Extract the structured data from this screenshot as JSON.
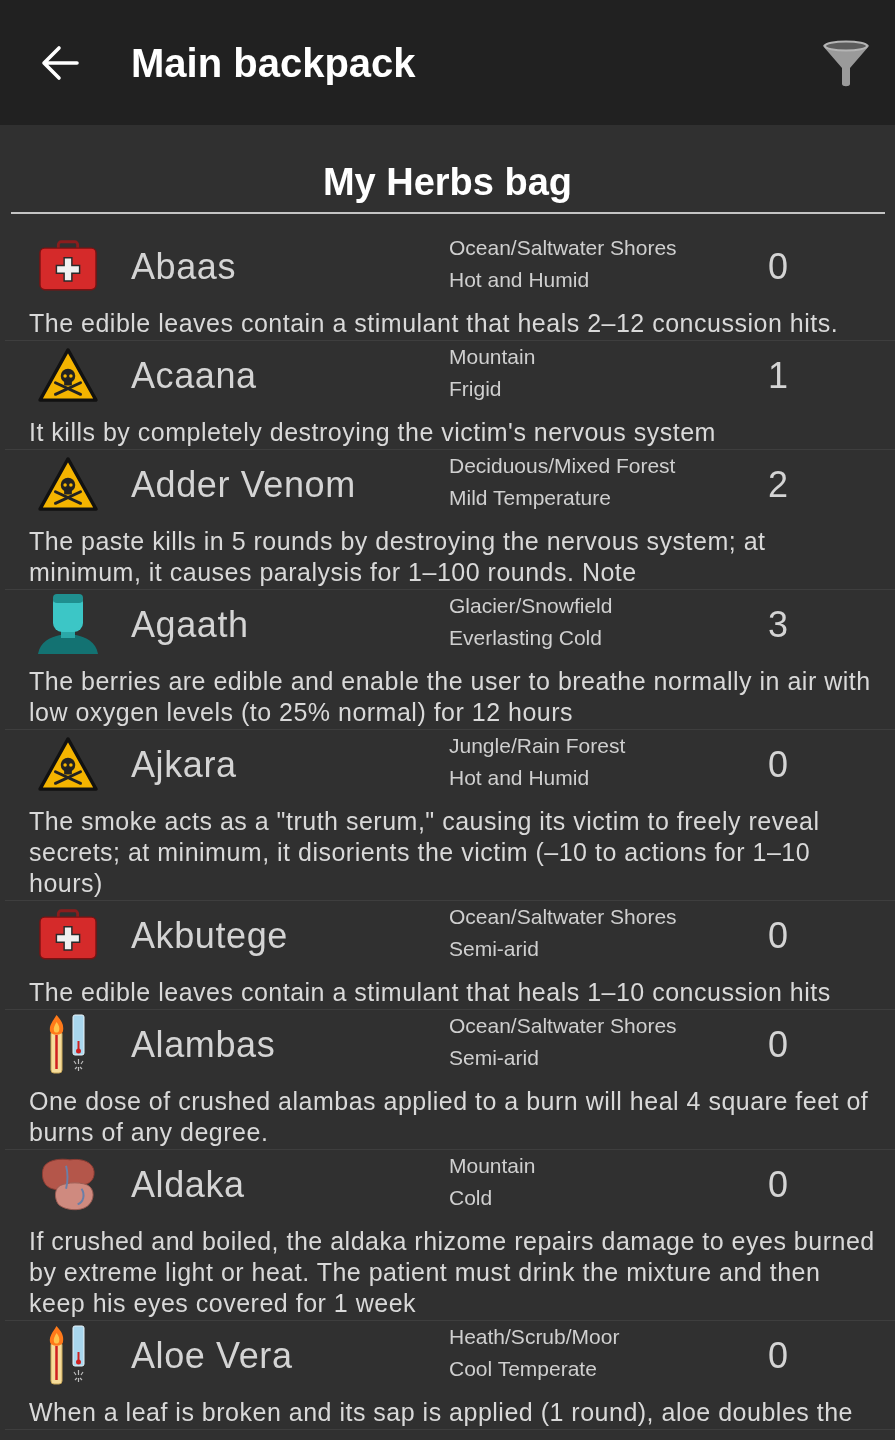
{
  "app_bar": {
    "title": "Main backpack"
  },
  "bag": {
    "title": "My Herbs bag"
  },
  "herbs": [
    {
      "kind": "medkit",
      "name": "Abaas",
      "terrain": "Ocean/Saltwater Shores",
      "climate": "Hot and Humid",
      "count": "0",
      "description": "The edible leaves contain a stimulant that heals 2–12 concussion hits."
    },
    {
      "kind": "hazard",
      "name": "Acaana",
      "terrain": "Mountain",
      "climate": "Frigid",
      "count": "1",
      "description": "It kills by completely destroying the victim's nervous system"
    },
    {
      "kind": "hazard",
      "name": "Adder Venom",
      "terrain": "Deciduous/Mixed Forest",
      "climate": "Mild Temperature",
      "count": "2",
      "description": "The paste kills in 5 rounds by destroying the nervous system; at minimum, it causes paralysis for 1–100 rounds. Note"
    },
    {
      "kind": "bust",
      "name": "Agaath",
      "terrain": "Glacier/Snowfield",
      "climate": "Everlasting Cold",
      "count": "3",
      "description": "The berries are edible and enable the user to breathe normally in air with low oxygen levels (to 25% normal) for 12 hours"
    },
    {
      "kind": "hazard",
      "name": "Ajkara",
      "terrain": "Jungle/Rain Forest",
      "climate": "Hot and Humid",
      "count": "0",
      "description": "The smoke acts as a \"truth serum,\" causing its victim to freely reveal secrets; at minimum, it disorients the victim (–10 to actions for 1–10 hours)"
    },
    {
      "kind": "medkit",
      "name": "Akbutege",
      "terrain": "Ocean/Saltwater Shores",
      "climate": "Semi-arid",
      "count": "0",
      "description": "The edible leaves contain a stimulant that heals 1–10 concussion hits"
    },
    {
      "kind": "thermometers",
      "name": "Alambas",
      "terrain": "Ocean/Saltwater Shores",
      "climate": "Semi-arid",
      "count": "0",
      "description": "One dose of crushed alambas applied to a burn will heal 4 square feet of burns of any degree."
    },
    {
      "kind": "organ",
      "name": "Aldaka",
      "terrain": "Mountain",
      "climate": "Cold",
      "count": "0",
      "description": "If crushed and boiled, the aldaka rhizome repairs damage to eyes burned by extreme light or heat. The patient must drink the mixture and then keep his eyes covered for 1 week"
    },
    {
      "kind": "thermometers",
      "name": "Aloe Vera",
      "terrain": "Heath/Scrub/Moor",
      "climate": "Cool Temperate",
      "count": "0",
      "description": "When a leaf is broken and its sap is applied (1 round), aloe doubles the"
    }
  ]
}
